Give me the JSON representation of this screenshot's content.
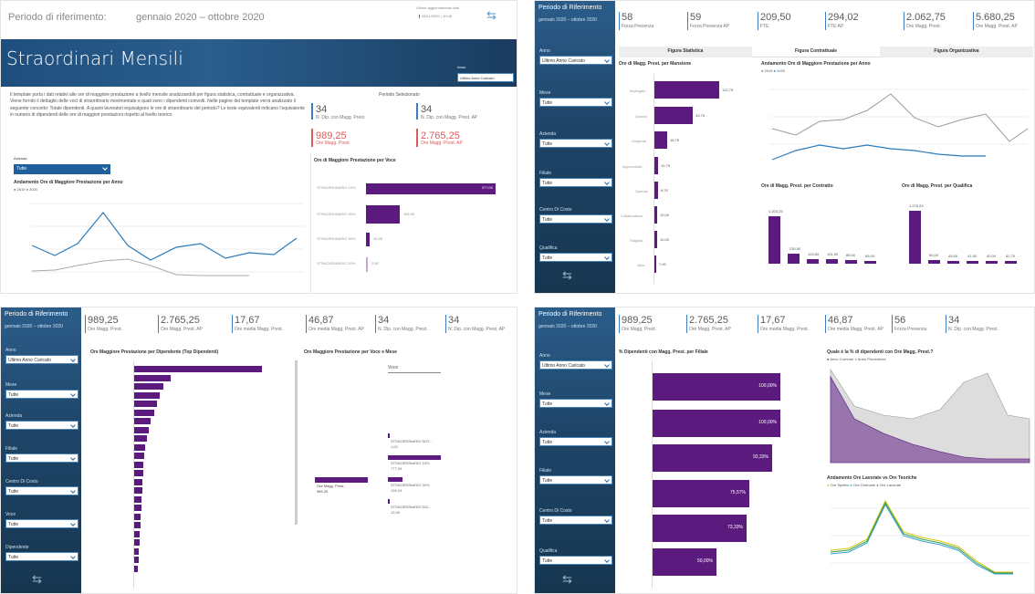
{
  "p1": {
    "header_label": "Periodo di riferimento:",
    "header_value": "gennaio 2020 – ottobre 2020",
    "update_label": "Ultimo aggiornamento dati",
    "update_value": "03/11/2020 | 10:48",
    "title": "Straordinari Mensili",
    "anno_label": "Anno",
    "anno_value": "Ultimo Anno Caricato",
    "desc": "Il template porta i dati relativi alle ore di maggiore prestazione a livello mensile analizzandoli per figura statistica, contrattuale e organizzativa. Viene fornito il dettaglio delle voci di straordinario movimentate e quali sono i dipendenti coinvolti. Nelle pagine del template verrà analizzato il seguente concetto: Totale dipendenti. A quanti lavoratori equivalgono le ore di straordinario del periodo? Le teste equivalenti indicano l'equivalente in numero di dipendenti delle ore di maggiori prestazioni rispetto al livello teorico.",
    "periodo_sel": "Periodo Selezionato",
    "kpis": [
      {
        "value": "34",
        "label": "N. Dip. con Magg. Prest."
      },
      {
        "value": "34",
        "label": "N. Dip. con Magg. Prest. AP"
      },
      {
        "value": "989,25",
        "label": "Ore Magg. Prest."
      },
      {
        "value": "2.765,25",
        "label": "Ore Magg. Prest. AP"
      }
    ],
    "azienda_label": "Azienda",
    "azienda_value": "Tutte",
    "line_title": "Andamento Ore di Maggiore Prestazione per Anno",
    "legend": [
      "2019",
      "2020"
    ],
    "bar_title": "Ore di Maggiore Prestazione per Voce",
    "bars": [
      {
        "label": "STRAORDINARIO 15%",
        "value": "377,00"
      },
      {
        "label": "STRAORDINARIO 30%",
        "value": "119,00"
      },
      {
        "label": "STRAORDINARIO 50%",
        "value": "10,00"
      },
      {
        "label": "STRAORDINARIO 20%",
        "value": "2,50"
      }
    ]
  },
  "p2": {
    "per": "Periodo di Riferimento",
    "perv": "gennaio 2020 – ottobre 2020",
    "kpis": [
      {
        "value": "58",
        "label": "Forza Presenza"
      },
      {
        "value": "59",
        "label": "Forza Presenza AP"
      },
      {
        "value": "209,50",
        "label": "FTE"
      },
      {
        "value": "294,02",
        "label": "FTE AP"
      },
      {
        "value": "2.062,75",
        "label": "Ore Magg. Prest."
      },
      {
        "value": "5.680,25",
        "label": "Ore Magg. Prest. AP"
      }
    ],
    "tabs": [
      "Figura Statistica",
      "Figura Contrattuale",
      "Figura Organizzativa"
    ],
    "filters": [
      {
        "label": "Anno",
        "value": "Ultimo Anno Caricato"
      },
      {
        "label": "Mese",
        "value": "Tutte"
      },
      {
        "label": "Azienda",
        "value": "Tutte"
      },
      {
        "label": "Filiale",
        "value": "Tutte"
      },
      {
        "label": "Centro Di Costo",
        "value": "Tutte"
      },
      {
        "label": "Qualifica",
        "value": "Tutte"
      }
    ],
    "bar_title": "Ore di Magg. Prest. per Mansione",
    "bars": [
      {
        "label": "Impiegato",
        "value": "102,75"
      },
      {
        "label": "Quadro",
        "value": "43,75"
      },
      {
        "label": "Dirigente",
        "value": "18,75"
      },
      {
        "label": "Apprendista",
        "value": "10,75"
      },
      {
        "label": "Operaio",
        "value": "8,75"
      },
      {
        "label": "Collaboratore",
        "value": "10,00"
      },
      {
        "label": "Stagista",
        "value": "10,00"
      },
      {
        "label": "Altro",
        "value": "7,00"
      }
    ],
    "line_title": "Andamento Ore di Maggiore Prestazione per Anno",
    "legend": [
      "2019",
      "2020"
    ],
    "contr_title": "Ore di Magg. Prest. per Contratto",
    "contr_values": [
      "1.203,25",
      "230,50",
      "103,50",
      "101,00",
      "85,00",
      "65,00"
    ],
    "qual_title": "Ore di Magg. Prest. per Qualifica",
    "qual_values": [
      "1.276,25",
      "50,00",
      "43,50",
      "41,50",
      "40,00",
      "42,75"
    ]
  },
  "p3": {
    "per": "Periodo di Riferimento",
    "perv": "gennaio 2020 – ottobre 2020",
    "kpis": [
      {
        "value": "989,25",
        "label": "Ore Magg. Prest."
      },
      {
        "value": "2.765,25",
        "label": "Ore Magg. Prest. AP"
      },
      {
        "value": "17,67",
        "label": "Ore media Magg. Prest."
      },
      {
        "value": "46,87",
        "label": "Ore media Magg. Prest. AP"
      },
      {
        "value": "34",
        "label": "N. Dip. con Magg. Prest."
      },
      {
        "value": "34",
        "label": "N. Dip. con Magg. Prest. AP"
      }
    ],
    "filters": [
      {
        "label": "Anno",
        "value": "Ultimo Anno Caricato"
      },
      {
        "label": "Mese",
        "value": "Tutte"
      },
      {
        "label": "Azienda",
        "value": "Tutte"
      },
      {
        "label": "Filiale",
        "value": "Tutte"
      },
      {
        "label": "Centro Di Costo",
        "value": "Tutte"
      },
      {
        "label": "Voce",
        "value": "Tutte"
      },
      {
        "label": "Dipendente",
        "value": "Tutte"
      }
    ],
    "left_title": "Ore Maggiore Prestazione per Dipendente (Top Dipendenti)",
    "right_title": "Ore Maggiore Prestazione per Voce e Mese",
    "voce_label": "Voce",
    "root_label": "Ore Magg. Prest.",
    "root_value": "989,25",
    "branches": [
      {
        "label": "STRAORDINARIO NOT...",
        "value": "1,00"
      },
      {
        "label": "STRAORDINARIO 15%",
        "value": "777,00"
      },
      {
        "label": "STRAORDINARIO 30%",
        "value": "199,24"
      },
      {
        "label": "STRAORDINARIO DIU...",
        "value": "12,00"
      }
    ]
  },
  "p4": {
    "per": "Periodo di Riferimento",
    "perv": "gennaio 2020 – ottobre 2020",
    "kpis": [
      {
        "value": "989,25",
        "label": "Ore Magg. Prest."
      },
      {
        "value": "2.765,25",
        "label": "Ore Magg. Prest. AP"
      },
      {
        "value": "17,67",
        "label": "Ore media Magg. Prest."
      },
      {
        "value": "46,87",
        "label": "Ore media Magg. Prest. AP"
      },
      {
        "value": "56",
        "label": "Forza Presenza"
      },
      {
        "value": "34",
        "label": "N. Dip. con Magg. Prest."
      }
    ],
    "filters": [
      {
        "label": "Anno",
        "value": "Ultimo Anno Caricato"
      },
      {
        "label": "Mese",
        "value": "Tutte"
      },
      {
        "label": "Azienda",
        "value": "Tutte"
      },
      {
        "label": "Filiale",
        "value": "Tutte"
      },
      {
        "label": "Centro Di Costo",
        "value": "Tutte"
      },
      {
        "label": "Qualifica",
        "value": "Tutte"
      }
    ],
    "bar_title": "% Dipendenti con Magg. Prest. per Filiale",
    "bars": [
      "100,00%",
      "100,00%",
      "93,33%",
      "75,57%",
      "73,33%",
      "50,00%"
    ],
    "area_title": "Quale è la % di dipendenti con Ore Magg. Prest.?",
    "area_legend": [
      "Anno Corrente",
      "Anno Precedente"
    ],
    "line_title": "Andamento Ore Lavorate vs Ore Teoriche",
    "line_legend": [
      "Ore Spettro",
      "Ore Ordinarie",
      "Ore Lavorate"
    ]
  }
}
